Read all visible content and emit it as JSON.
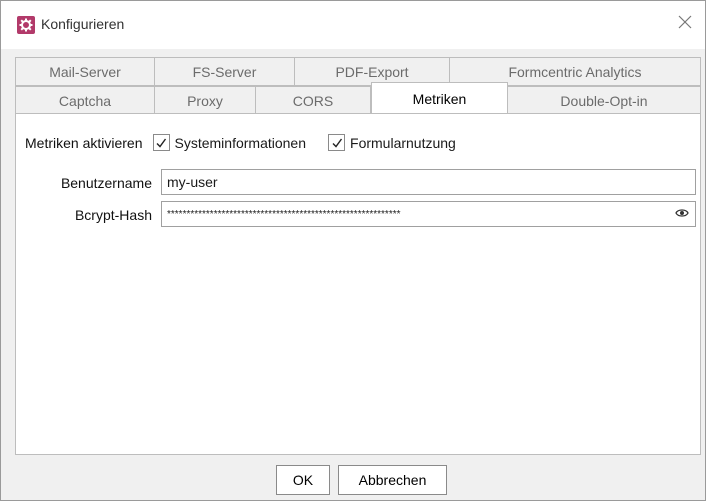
{
  "window": {
    "title": "Konfigurieren",
    "icon": "gear-icon",
    "accent": "#b23a6a"
  },
  "tabs": {
    "row1": [
      "Mail-Server",
      "FS-Server",
      "PDF-Export",
      "Formcentric Analytics"
    ],
    "row2": [
      "Captcha",
      "Proxy",
      "CORS",
      "Metriken",
      "Double-Opt-in"
    ],
    "selected": "Metriken"
  },
  "metrics": {
    "label": "Metriken aktivieren",
    "options": [
      {
        "label": "Systeminformationen",
        "checked": true
      },
      {
        "label": "Formularnutzung",
        "checked": true
      }
    ]
  },
  "username": {
    "label": "Benutzername",
    "value": "my-user"
  },
  "hash": {
    "label": "Bcrypt-Hash",
    "value": "************************************************************",
    "icon": "eye-icon"
  },
  "buttons": {
    "ok": "OK",
    "cancel": "Abbrechen"
  }
}
